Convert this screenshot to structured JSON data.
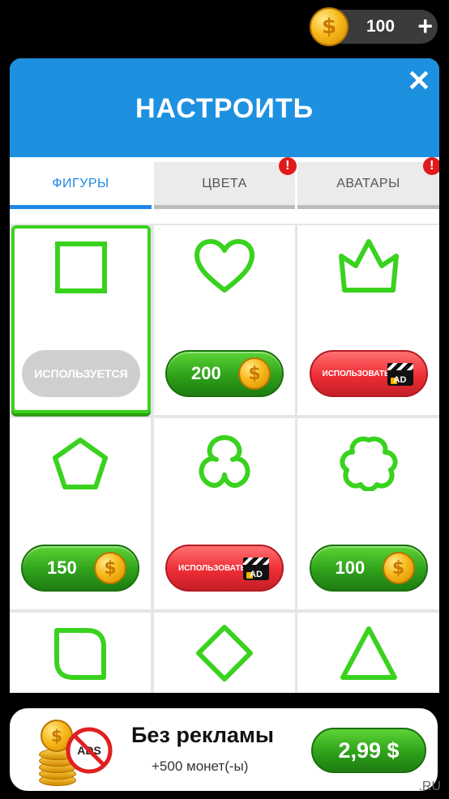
{
  "wallet": {
    "coins": "100",
    "plus_label": "+",
    "coin_glyph": "$"
  },
  "dialog": {
    "title": "НАСТРОИТЬ",
    "close_label": "✕",
    "tabs": [
      {
        "label": "ФИГУРЫ",
        "active": true,
        "alert": false
      },
      {
        "label": "ЦВЕТА",
        "active": false,
        "alert": true
      },
      {
        "label": "АВАТАРЫ",
        "active": false,
        "alert": true
      }
    ],
    "alert_glyph": "!"
  },
  "shapes": [
    {
      "icon": "square-shape-icon",
      "status": "selected",
      "label": "ИСПОЛЬЗУЕТСЯ"
    },
    {
      "icon": "heart-shape-icon",
      "status": "price",
      "price": "200"
    },
    {
      "icon": "crown-shape-icon",
      "status": "ad",
      "label": "ИСПОЛЬЗОВАТЬ",
      "ad_label": "AD"
    },
    {
      "icon": "pentagon-shape-icon",
      "status": "price",
      "price": "150"
    },
    {
      "icon": "clover-shape-icon",
      "status": "ad",
      "label": "ИСПОЛЬЗОВАТЬ",
      "ad_label": "AD"
    },
    {
      "icon": "flower-shape-icon",
      "status": "price",
      "price": "100"
    },
    {
      "icon": "leaf-square-shape-icon"
    },
    {
      "icon": "diamond-shape-icon"
    },
    {
      "icon": "triangle-shape-icon"
    }
  ],
  "banner": {
    "title": "Без рекламы",
    "subtitle": "+500 монет(-ы)",
    "price": "2,99 $",
    "ads_label": "ADS"
  },
  "watermark": ".RU",
  "colors": {
    "accent": "#1e90e0",
    "shape": "#39d21e",
    "buy_green": "#2fa11b",
    "ad_red": "#ee2d35"
  }
}
